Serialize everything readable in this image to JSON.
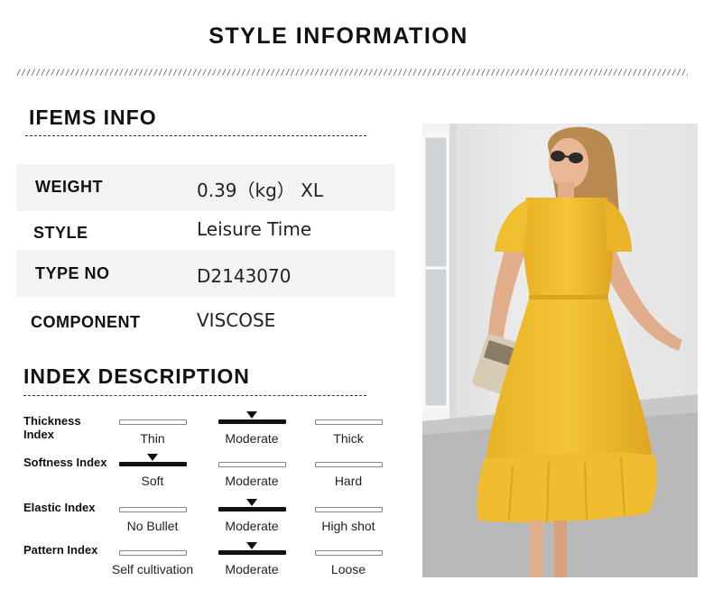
{
  "page": {
    "title": "STYLE INFORMATION",
    "items_title": "IFEMS INFO",
    "index_title": "INDEX DESCRIPTION"
  },
  "info": [
    {
      "key": "WEIGHT",
      "value": "0.39（kg） XL"
    },
    {
      "key": "STYLE",
      "value": "Leisure Time"
    },
    {
      "key": "TYPE NO",
      "value": "D2143070"
    },
    {
      "key": "COMPONENT",
      "value": "VISCOSE"
    }
  ],
  "index": [
    {
      "label": "Thickness Index",
      "options": [
        "Thin",
        "Moderate",
        "Thick"
      ],
      "selected": 1
    },
    {
      "label": "Softness Index",
      "options": [
        "Soft",
        "Moderate",
        "Hard"
      ],
      "selected": 0
    },
    {
      "label": "Elastic Index",
      "options": [
        "No Bullet",
        "Moderate",
        "High shot"
      ],
      "selected": 1
    },
    {
      "label": "Pattern Index",
      "options": [
        "Self cultivation",
        "Moderate",
        "Loose"
      ],
      "selected": 1
    }
  ],
  "colors": {
    "dress": "#f2c12e",
    "dress_shadow": "#d9a520",
    "wall": "#e9e9e9",
    "shaded_row": "#f3f3f3"
  }
}
